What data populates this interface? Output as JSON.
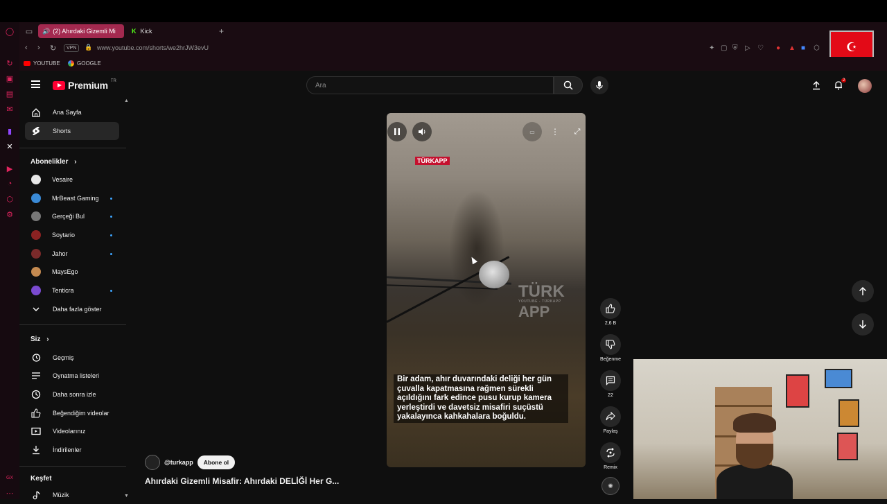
{
  "browser": {
    "tabs": [
      {
        "label": "(2) Ahırdaki Gizemli Mi",
        "active": true
      },
      {
        "label": "Kick",
        "active": false
      }
    ],
    "vpn_label": "VPN",
    "url": "www.youtube.com/shorts/we2hrJW3evU",
    "bookmarks": [
      {
        "label": "YOUTUBE"
      },
      {
        "label": "GOOGLE"
      }
    ]
  },
  "header": {
    "logo_text": "Premium",
    "logo_country": "TR",
    "search_placeholder": "Ara",
    "notification_count": "2"
  },
  "sidebar": {
    "main": [
      {
        "label": "Ana Sayfa",
        "icon": "home-icon"
      },
      {
        "label": "Shorts",
        "icon": "shorts-icon",
        "active": true
      }
    ],
    "subscriptions_title": "Abonelikler",
    "subscriptions": [
      {
        "label": "Vesaire",
        "color": "#e8e8e8",
        "dot": false
      },
      {
        "label": "MrBeast Gaming",
        "color": "#3a8ad6",
        "dot": true
      },
      {
        "label": "Gerçeği Bul",
        "color": "#777777",
        "dot": true
      },
      {
        "label": "Soytario",
        "color": "#8a2222",
        "dot": true
      },
      {
        "label": "Jahor",
        "color": "#7a2a2a",
        "dot": true
      },
      {
        "label": "MaysEgo",
        "color": "#c48a50",
        "dot": false
      },
      {
        "label": "Tenticra",
        "color": "#7a4ad0",
        "dot": true
      }
    ],
    "show_more": "Daha fazla göster",
    "you_title": "Siz",
    "you_items": [
      {
        "label": "Geçmiş",
        "icon": "history-icon"
      },
      {
        "label": "Oynatma listeleri",
        "icon": "playlists-icon"
      },
      {
        "label": "Daha sonra izle",
        "icon": "watch-later-icon"
      },
      {
        "label": "Beğendiğim videolar",
        "icon": "liked-videos-icon"
      },
      {
        "label": "Videolarınız",
        "icon": "your-videos-icon"
      },
      {
        "label": "İndirilenler",
        "icon": "downloads-icon"
      }
    ],
    "explore_title": "Keşfet",
    "explore_items": [
      {
        "label": "Müzik",
        "icon": "music-icon"
      }
    ]
  },
  "video": {
    "brand": "TÜRKAPP",
    "watermark_main": "TÜRK",
    "watermark_sub": "YOUTUBE - TÜRKAPP",
    "watermark_app": "APP",
    "caption": "Bir adam, ahır duvarındaki deliği her gün çuvalla kapatmasına rağmen sürekli açıldığını fark edince pusu kurup kamera yerleştirdi ve davetsiz misafiri suçüstü yakalayınca kahkahalara boğuldu.",
    "channel": "@turkapp",
    "subscribe_label": "Abone ol",
    "title": "Ahırdaki Gizemli Misafir: Ahırdaki DELİĞİ Her G..."
  },
  "actions": {
    "like_count": "2,6 B",
    "dislike_label": "Beğenme",
    "comment_count": "22",
    "share_label": "Paylaş",
    "remix_label": "Remix"
  }
}
